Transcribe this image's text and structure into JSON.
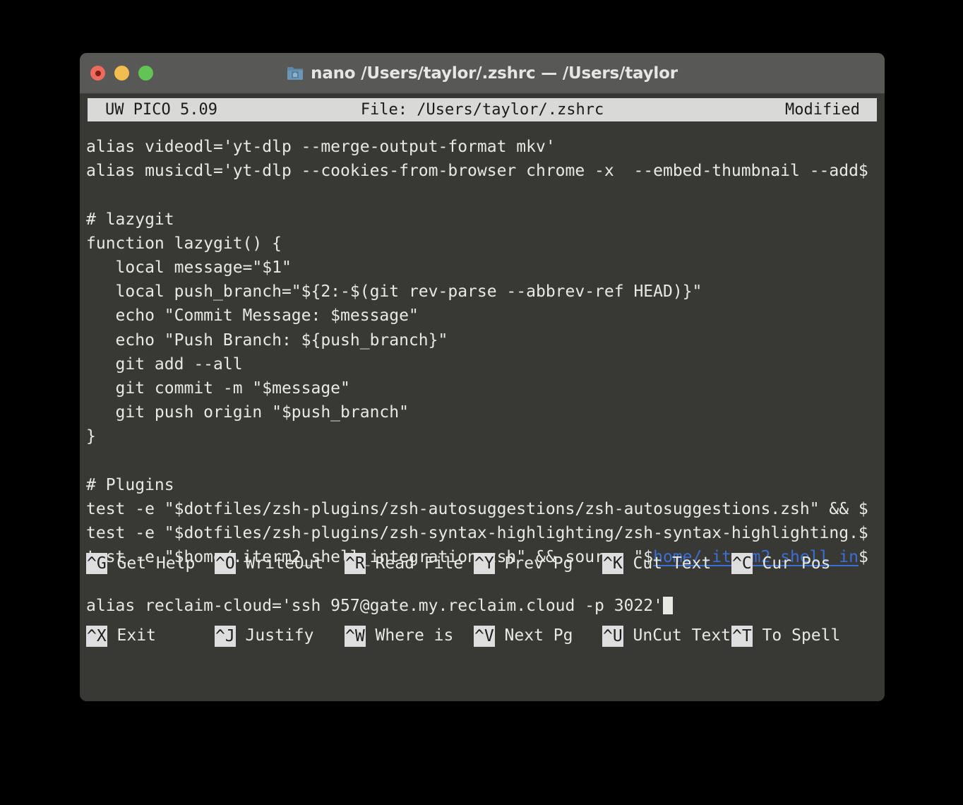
{
  "window": {
    "title": "nano /Users/taylor/.zshrc — /Users/taylor",
    "folder_icon": "home-folder-icon",
    "traffic_lights": {
      "close_label": "close",
      "minimize_label": "minimize",
      "zoom_label": "zoom"
    },
    "colors": {
      "titlebar_bg": "#585856",
      "terminal_bg": "#383935",
      "text": "#e9e9e4",
      "header_bg": "#d9d9d7",
      "header_text": "#1b1b1b",
      "link": "#3b6fd6",
      "traffic_red": "#ed6a5e",
      "traffic_yellow": "#f4bd4f",
      "traffic_green": "#61c454"
    }
  },
  "editor": {
    "header": {
      "version": "UW PICO 5.09",
      "file": "File: /Users/taylor/.zshrc",
      "status": "Modified"
    },
    "lines": [
      {
        "text": "alias videodl='yt-dlp --merge-output-format mkv'"
      },
      {
        "text": "alias musicdl='yt-dlp --cookies-from-browser chrome -x  --embed-thumbnail --add$"
      },
      {
        "text": ""
      },
      {
        "text": "# lazygit"
      },
      {
        "text": "function lazygit() {"
      },
      {
        "text": "   local message=\"$1\""
      },
      {
        "text": "   local push_branch=\"${2:-$(git rev-parse --abbrev-ref HEAD)}\""
      },
      {
        "text": "   echo \"Commit Message: $message\""
      },
      {
        "text": "   echo \"Push Branch: ${push_branch}\""
      },
      {
        "text": "   git add --all"
      },
      {
        "text": "   git commit -m \"$message\""
      },
      {
        "text": "   git push origin \"$push_branch\""
      },
      {
        "text": "}"
      },
      {
        "text": ""
      },
      {
        "text": "# Plugins"
      },
      {
        "text": "test -e \"$dotfiles/zsh-plugins/zsh-autosuggestions/zsh-autosuggestions.zsh\" && $"
      },
      {
        "text": "test -e \"$dotfiles/zsh-plugins/zsh-syntax-highlighting/zsh-syntax-highlighting.$"
      },
      {
        "segments": [
          {
            "text": "test -e \"$home/.iterm2_shell_integration.zsh\" && source \"$",
            "style": "plain"
          },
          {
            "text": "home/.iterm2_shell_in",
            "style": "link"
          },
          {
            "text": "$",
            "style": "plain"
          }
        ]
      },
      {
        "text": ""
      },
      {
        "text": "alias reclaim-cloud='ssh 957@gate.my.reclaim.cloud -p 3022'",
        "cursor": true
      }
    ]
  },
  "shortcuts": {
    "row1": [
      {
        "key": "^G",
        "label": " Get Help"
      },
      {
        "key": "^O",
        "label": " WriteOut"
      },
      {
        "key": "^R",
        "label": " Read File"
      },
      {
        "key": "^Y",
        "label": " Prev Pg"
      },
      {
        "key": "^K",
        "label": " Cut Text"
      },
      {
        "key": "^C",
        "label": " Cur Pos"
      }
    ],
    "row2": [
      {
        "key": "^X",
        "label": " Exit"
      },
      {
        "key": "^J",
        "label": " Justify"
      },
      {
        "key": "^W",
        "label": " Where is"
      },
      {
        "key": "^V",
        "label": " Next Pg"
      },
      {
        "key": "^U",
        "label": " UnCut Text"
      },
      {
        "key": "^T",
        "label": " To Spell"
      }
    ]
  }
}
